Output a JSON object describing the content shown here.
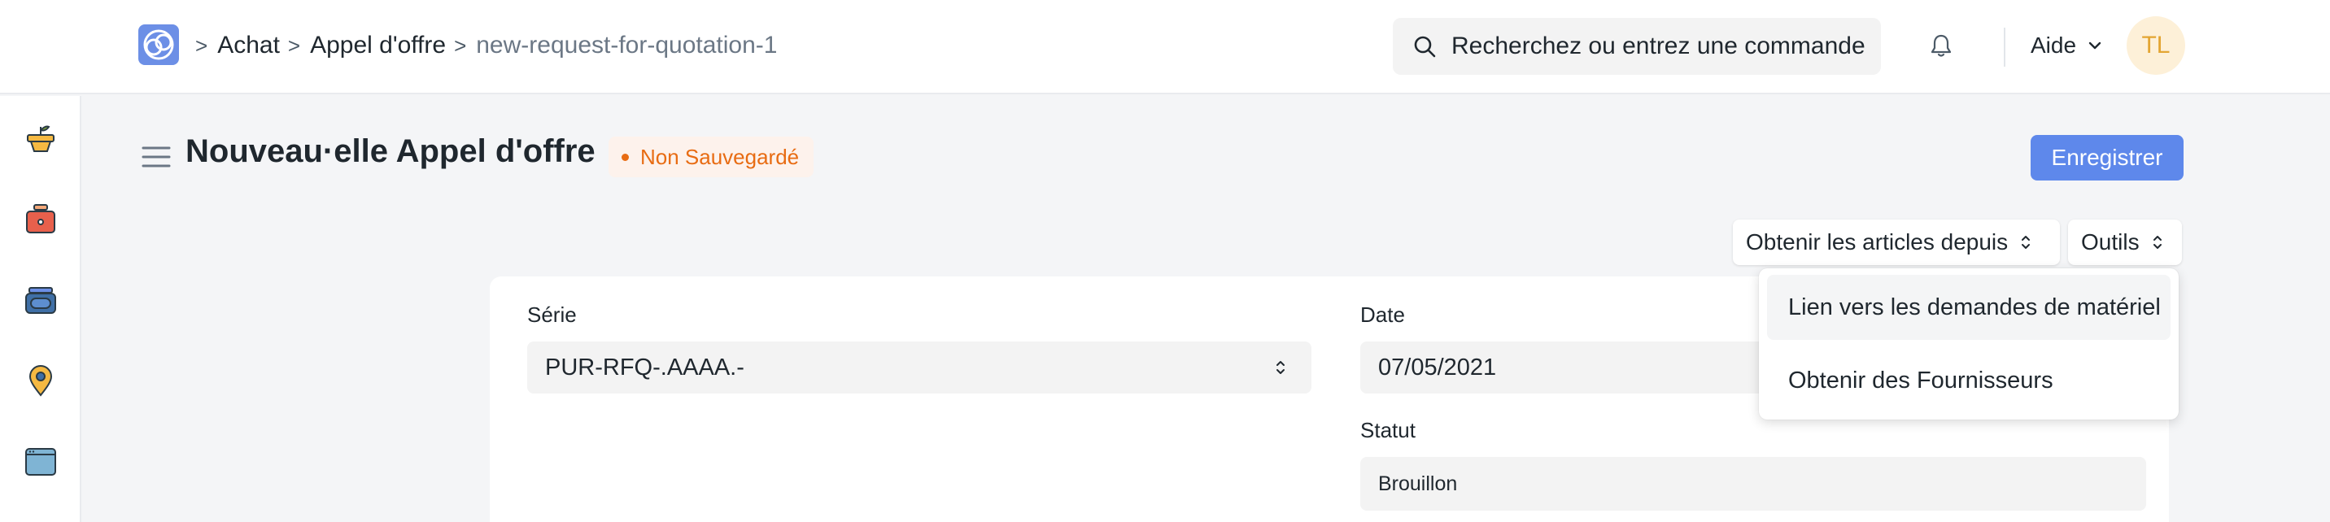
{
  "navbar": {
    "breadcrumbs": [
      {
        "label": "Achat"
      },
      {
        "label": "Appel d'offre"
      },
      {
        "label": "new-request-for-quotation-1"
      }
    ],
    "search": {
      "placeholder": "Recherchez ou entrez une commande",
      "icon": "search-icon"
    },
    "help_label": "Aide",
    "avatar_initials": "TL",
    "colors": {
      "avatar_bg": "#fdf0d8",
      "avatar_text": "#e3a532"
    }
  },
  "sidebar": {
    "icons": [
      "plant-pot-icon",
      "toolbox-icon",
      "drive-icon",
      "location-pin-icon",
      "window-icon"
    ]
  },
  "page": {
    "title": "Nouveau·elle Appel d'offre",
    "status_badge": "Non Sauvegardé",
    "save_label": "Enregistrer",
    "get_items_label": "Obtenir les articles depuis",
    "tools_label": "Outils",
    "colors": {
      "primary": "#5e88eb",
      "badge_text": "#e86c13",
      "badge_bg": "#fdf2ec"
    }
  },
  "form": {
    "serie": {
      "label": "Série",
      "value": "PUR-RFQ-.AAAA.-"
    },
    "date": {
      "label": "Date",
      "value": "07/05/2021"
    },
    "statut": {
      "label": "Statut",
      "value": "Brouillon"
    }
  },
  "tools_menu": {
    "items": [
      {
        "label": "Lien vers les demandes de matériel"
      },
      {
        "label": "Obtenir des Fournisseurs"
      }
    ]
  }
}
